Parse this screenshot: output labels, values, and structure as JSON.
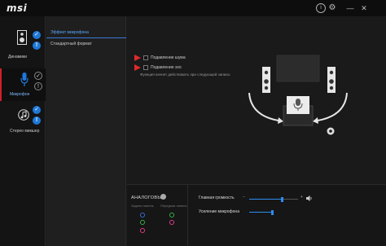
{
  "app": {
    "logo": "msi"
  },
  "titlebar": {
    "info_icon": "info-icon",
    "settings_icon": "gear-icon",
    "minimize_label": "—",
    "close_label": "✕"
  },
  "devices": [
    {
      "label": "Динамики",
      "icon": "speaker-icon",
      "default": true,
      "selected": false
    },
    {
      "label": "Микрофон",
      "icon": "microphone-icon",
      "default": false,
      "selected": true
    },
    {
      "label": "Стерео микшер",
      "icon": "music-icon",
      "default": true,
      "selected": false
    }
  ],
  "submenu": {
    "tabs": [
      {
        "label": "Эффект микрофона",
        "active": true
      },
      {
        "label": "Стандартный формат",
        "active": false
      }
    ]
  },
  "effects": {
    "noise_suppression": {
      "label": "Подавление шума",
      "checked": false
    },
    "echo_cancellation": {
      "label": "Подавление эхо",
      "checked": false
    },
    "note": "Функция начнет действовать при следующей записи."
  },
  "analog": {
    "title": "АНАЛОГОВЫЙ",
    "rear_panel": "Задняя панель",
    "front_panel": "Передняя панель",
    "jack_colors": {
      "blue": "#3a6fd8",
      "green": "#3ab04a",
      "pink": "#e0408a"
    }
  },
  "volume": {
    "master_label": "Главная громкость",
    "master_level": 0.68,
    "minus": "−",
    "plus": "+",
    "mic_boost_label": "Усиление микрофона",
    "mic_boost_level": 1.0
  },
  "colors": {
    "accent": "#1e78d8",
    "alert": "#e02a2a"
  }
}
